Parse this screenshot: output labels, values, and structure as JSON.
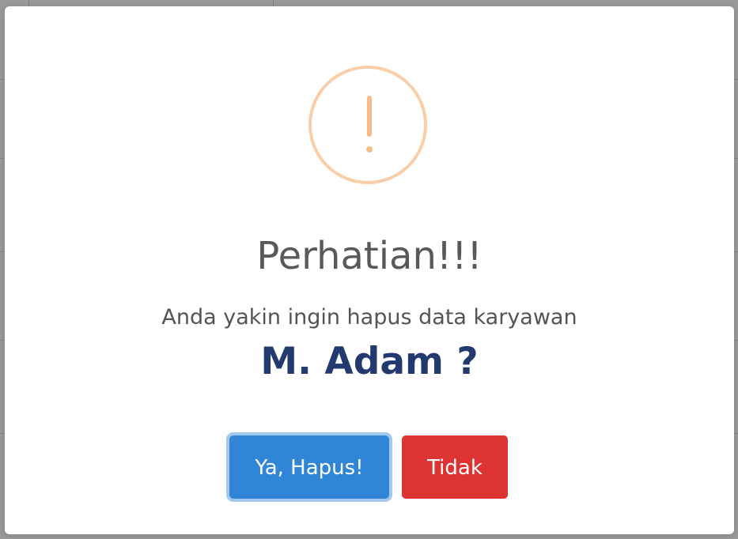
{
  "dialog": {
    "title": "Perhatian!!!",
    "message": "Anda yakin ingin hapus data karyawan",
    "employee_name": "M. Adam ?",
    "icon": "warning-icon",
    "confirm_label": "Ya, Hapus!",
    "cancel_label": "Tidak"
  },
  "colors": {
    "icon_border": "#facea8",
    "icon_mark": "#f8bb86",
    "confirm_button": "#3085d6",
    "cancel_button": "#dd3333",
    "employee_text": "#223a6e",
    "overlay": "rgba(0,0,0,0.4)"
  }
}
